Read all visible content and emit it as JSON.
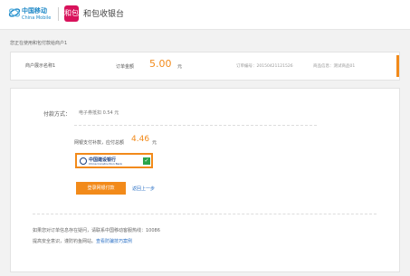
{
  "header": {
    "cm_logo_cn": "中国移动",
    "cm_logo_en": "China Mobile",
    "hebao_icon_text": "和包",
    "title": "和包收银台"
  },
  "welcome": "您正在使用和包付款给商户1",
  "order": {
    "merchant": "商户展示名称1",
    "amount_label": "订单金额",
    "amount_value": "5.00",
    "amount_unit": "元",
    "order_no": "订单编号：20150421121526",
    "product": "商品信息：测试商品01"
  },
  "payment": {
    "method_label": "付款方式：",
    "method_value": "电子券抵扣 0.54 元",
    "need_label": "网银支付补款，应付总额",
    "need_value": "4.46",
    "need_unit": "元",
    "bank_name_cn": "中国建设银行",
    "bank_name_en": "China Construction Bank",
    "check_mark": "✓",
    "pay_button": "登录网银付款",
    "back_link": "返回上一步"
  },
  "notes": {
    "line1": "如果您对订单信息存在疑问，请联系中国移动客服热线：10086",
    "line2_prefix": "提高安全意识，谨防钓鱼网站。",
    "line2_link": "查看防骗技巧案例"
  }
}
